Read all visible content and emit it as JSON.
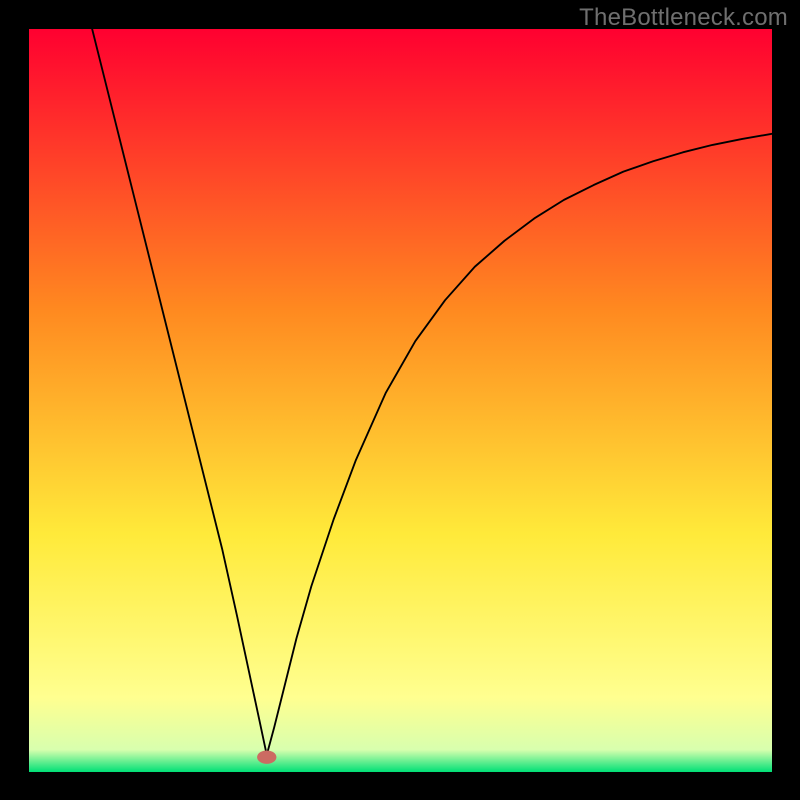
{
  "watermark": "TheBottleneck.com",
  "chart_data": {
    "type": "line",
    "title": "",
    "xlabel": "",
    "ylabel": "",
    "xlim": [
      0,
      100
    ],
    "ylim": [
      0,
      100
    ],
    "grid": false,
    "legend": false,
    "background_gradient": {
      "top_color": "#ff0030",
      "mid_upper_color": "#ff8a20",
      "mid_color": "#ffea3a",
      "mid_lower_color": "#ffff90",
      "bottom_color": "#00e076"
    },
    "marker": {
      "x": 32,
      "y": 2,
      "color": "#cc6b62",
      "rx": 1.3,
      "ry": 0.9
    },
    "series": [
      {
        "name": "bottleneck-curve",
        "color": "#000000",
        "x": [
          8.5,
          10,
          12,
          14,
          16,
          18,
          20,
          22,
          24,
          26,
          28,
          29.5,
          31,
          32,
          33,
          34.5,
          36,
          38,
          41,
          44,
          48,
          52,
          56,
          60,
          64,
          68,
          72,
          76,
          80,
          84,
          88,
          92,
          96,
          100
        ],
        "values": [
          100,
          94,
          86,
          78,
          70,
          62,
          54,
          46,
          38,
          30,
          21,
          14,
          7,
          2.3,
          6,
          12,
          18,
          25,
          34,
          42,
          51,
          58,
          63.5,
          68,
          71.5,
          74.5,
          77,
          79,
          80.8,
          82.2,
          83.4,
          84.4,
          85.2,
          85.9
        ]
      }
    ]
  }
}
